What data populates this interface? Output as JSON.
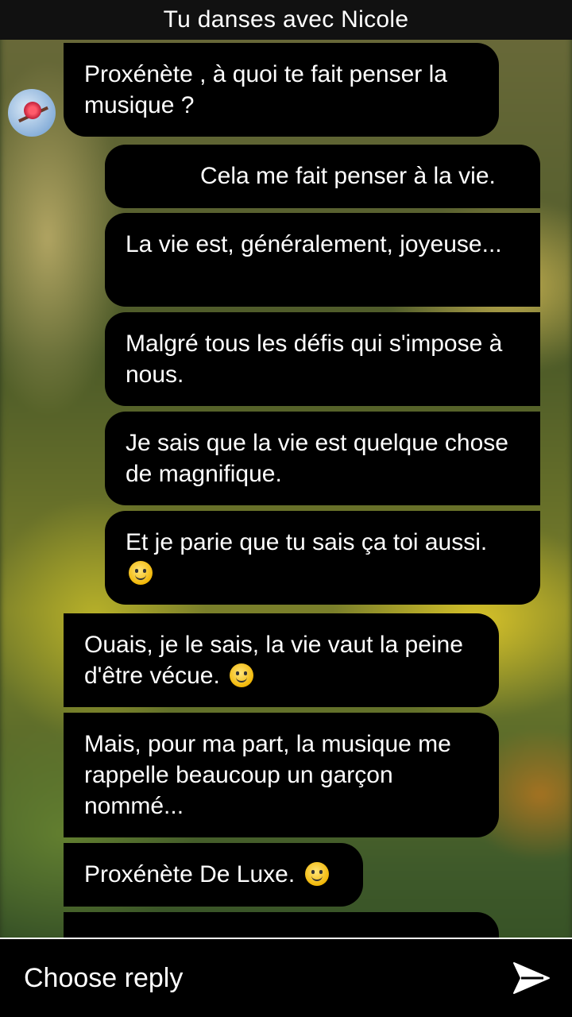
{
  "header": {
    "title": "Tu danses avec Nicole"
  },
  "messages": [
    {
      "side": "left",
      "text": "Proxénète , à quoi te fait penser la musique ?"
    },
    {
      "side": "right",
      "text": "Cela me fait penser à la vie."
    },
    {
      "side": "right",
      "text": "La vie est, généralement, joyeuse..."
    },
    {
      "side": "right",
      "text": "Malgré tous les défis qui s'impose à nous."
    },
    {
      "side": "right",
      "text": "Je sais que la vie est quelque chose de magnifique."
    },
    {
      "side": "right",
      "text": "Et je parie que tu sais ça toi aussi.",
      "emoji": "smiley"
    },
    {
      "side": "left",
      "text": "Ouais, je le sais, la vie vaut la peine d'être vécue.",
      "emoji": "smiley"
    },
    {
      "side": "left",
      "text": "Mais, pour ma part, la musique me rappelle beaucoup un garçon nommé..."
    },
    {
      "side": "left",
      "text": "Proxénète De Luxe.",
      "emoji": "smiley"
    }
  ],
  "footer": {
    "reply_label": "Choose reply",
    "send_icon": "send-arrow-icon"
  }
}
